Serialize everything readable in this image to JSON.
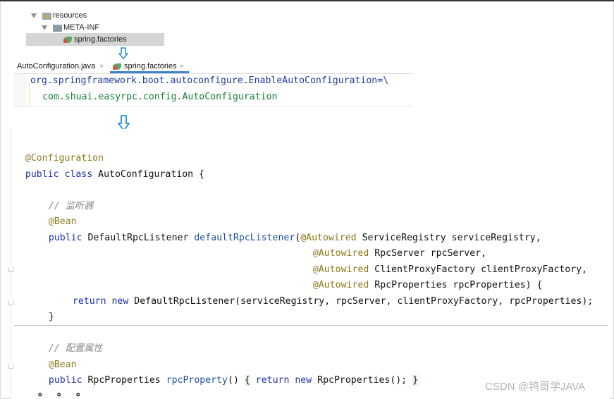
{
  "project_tree": {
    "items": [
      {
        "label": "resources",
        "icon": "resources-folder-icon"
      },
      {
        "label": "META-INF",
        "icon": "folder-icon"
      },
      {
        "label": "spring.factories",
        "icon": "spring-leaf-icon",
        "selected": true
      }
    ]
  },
  "editor_tabs": [
    {
      "label": "AutoConfiguration.java",
      "close": "×",
      "active": false
    },
    {
      "label": "spring.factories",
      "close": "×",
      "active": true
    }
  ],
  "factories_file": {
    "line1": "org.springframework.boot.autoconfigure.EnableAutoConfiguration=\\",
    "line2": "com.shuai.easyrpc.config.AutoConfiguration"
  },
  "code": {
    "annotation_configuration": "@Configuration",
    "class_decl_kw": "public class",
    "class_name": "AutoConfiguration {",
    "comment_listener": "// 监听器",
    "bean_1": "@Bean",
    "m1_public": "public",
    "m1_type": "DefaultRpcListener",
    "m1_name": "defaultRpcListener",
    "m1_paren": "(",
    "autowired": "@Autowired",
    "p1": "ServiceRegistry serviceRegistry,",
    "p2": "RpcServer rpcServer,",
    "p3": "ClientProxyFactory clientProxyFactory,",
    "p4": "RpcProperties rpcProperties) {",
    "ret_kw": "return",
    "new_kw": "new",
    "ret_expr": "DefaultRpcListener(serviceRegistry, rpcServer, clientProxyFactory, rpcProperties);",
    "close_brace": "}",
    "comment_props": "// 配置属性",
    "bean_2": "@Bean",
    "m2_public": "public",
    "m2_type": "RpcProperties",
    "m2_name": "rpcProperty",
    "m2_parens": "()",
    "m2_open": "{",
    "m2_ret": "return",
    "m2_new": "new",
    "m2_body": "RpcProperties();",
    "m2_close": "}"
  },
  "ellipsis": "。。。",
  "watermark": "CSDN @鸨哥学JAVA",
  "colors": {
    "keyword": "#1c2fa8",
    "annotation": "#8c7a1d",
    "method": "#1d4f9a",
    "comment": "#8a8a8a",
    "property_key": "#1f3d9e",
    "property_value": "#167e37",
    "arrow": "#1e90d6"
  }
}
